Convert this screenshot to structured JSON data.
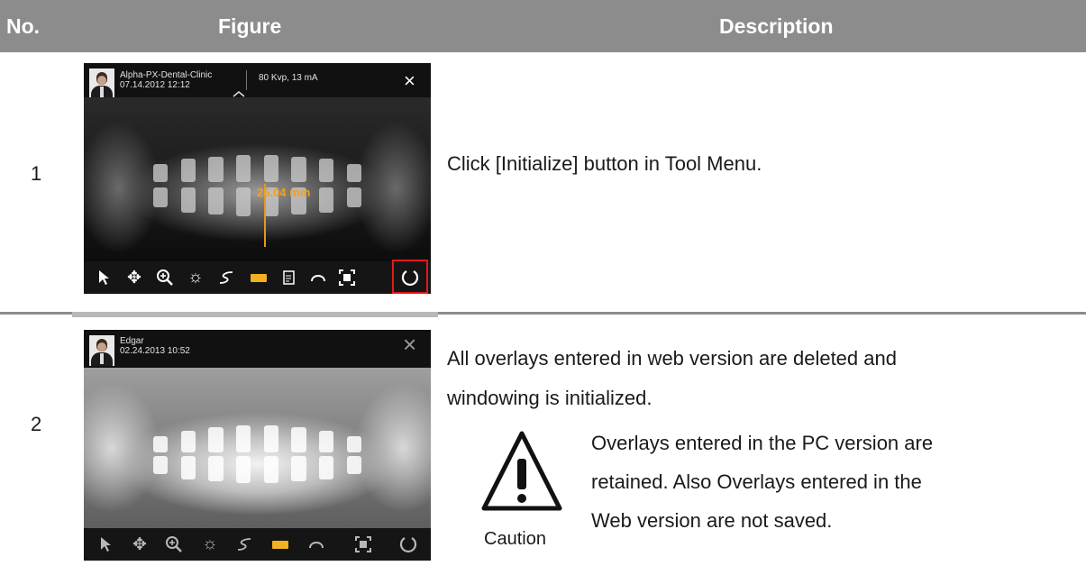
{
  "header": {
    "no": "No.",
    "figure": "Figure",
    "description": "Description"
  },
  "rows": [
    {
      "number": "1",
      "figure": {
        "clinic": "Alpha-PX-Dental-Clinic",
        "datetime": "07.14.2012 12:12",
        "exposure": "80 Kvp, 13 mA",
        "close": "×",
        "measurement": "26.04 mm",
        "toolbar_icons": [
          "select-icon",
          "pan-icon",
          "zoom-icon",
          "brightness-icon",
          "freehand-icon",
          "ruler-icon",
          "note-icon",
          "undo-icon",
          "fit-icon",
          "initialize-icon"
        ],
        "highlighted_tool": "initialize-icon",
        "highlight_color": "#e01b1b"
      },
      "description": "Click [Initialize] button in Tool Menu."
    },
    {
      "number": "2",
      "figure": {
        "patient": "Edgar",
        "datetime": "02.24.2013 10:52",
        "close": "×",
        "toolbar_icons": [
          "select-icon",
          "pan-icon",
          "zoom-icon",
          "brightness-icon",
          "freehand-icon",
          "ruler-icon",
          "undo-icon",
          "fit-icon",
          "initialize-icon"
        ]
      },
      "description_line1": "All overlays entered in web version are deleted and",
      "description_line2": "windowing is initialized.",
      "caution": {
        "label": "Caution",
        "line1": "Overlays entered in the PC version are",
        "line2": "retained. Also Overlays entered in the",
        "line3": "Web version are not saved."
      }
    }
  ],
  "colors": {
    "header_bg": "#8c8c8c",
    "measure": "#f2a023"
  }
}
